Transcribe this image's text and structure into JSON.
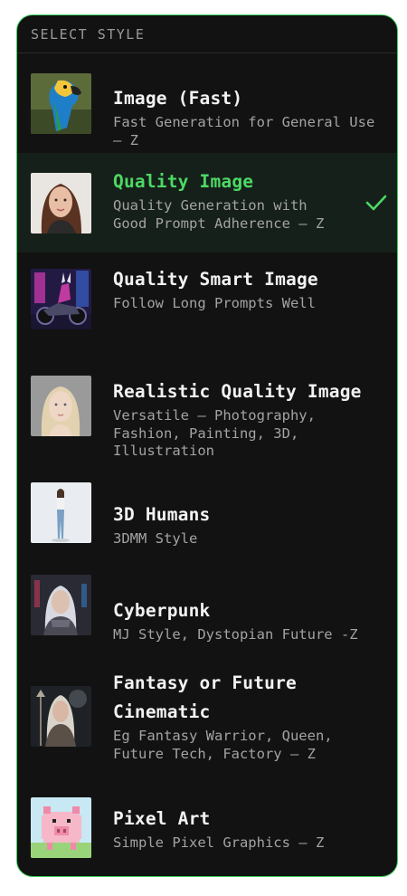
{
  "header": {
    "title": "SELECT STYLE"
  },
  "accent_color": "#4cd964",
  "items": [
    {
      "title": "Image (Fast)",
      "description": "Fast Generation for General Use\n— Z",
      "selected": false,
      "thumb_icon": "parrot-thumbnail"
    },
    {
      "title": "Quality Image",
      "description": "Quality Generation with\nGood Prompt Adherence — Z",
      "selected": true,
      "thumb_icon": "woman-portrait-thumbnail"
    },
    {
      "title": "Quality Smart Image",
      "description": "Follow Long Prompts Well",
      "selected": false,
      "thumb_icon": "motorcycle-rider-thumbnail"
    },
    {
      "title": "Realistic Quality Image",
      "description": "Versatile — Photography,\nFashion, Painting, 3D,\nIllustration",
      "selected": false,
      "thumb_icon": "blonde-portrait-thumbnail"
    },
    {
      "title": "3D Humans",
      "description": "3DMM Style",
      "selected": false,
      "thumb_icon": "standing-woman-thumbnail"
    },
    {
      "title": "Cyberpunk",
      "description": "MJ Style, Dystopian Future -Z",
      "selected": false,
      "thumb_icon": "cyber-woman-thumbnail"
    },
    {
      "title": "Fantasy or Future\nCinematic",
      "description": "Eg Fantasy Warrior, Queen,\nFuture Tech, Factory — Z",
      "selected": false,
      "thumb_icon": "warrior-queen-thumbnail"
    },
    {
      "title": "Pixel Art",
      "description": "Simple Pixel Graphics — Z",
      "selected": false,
      "thumb_icon": "pixel-pig-thumbnail"
    }
  ]
}
